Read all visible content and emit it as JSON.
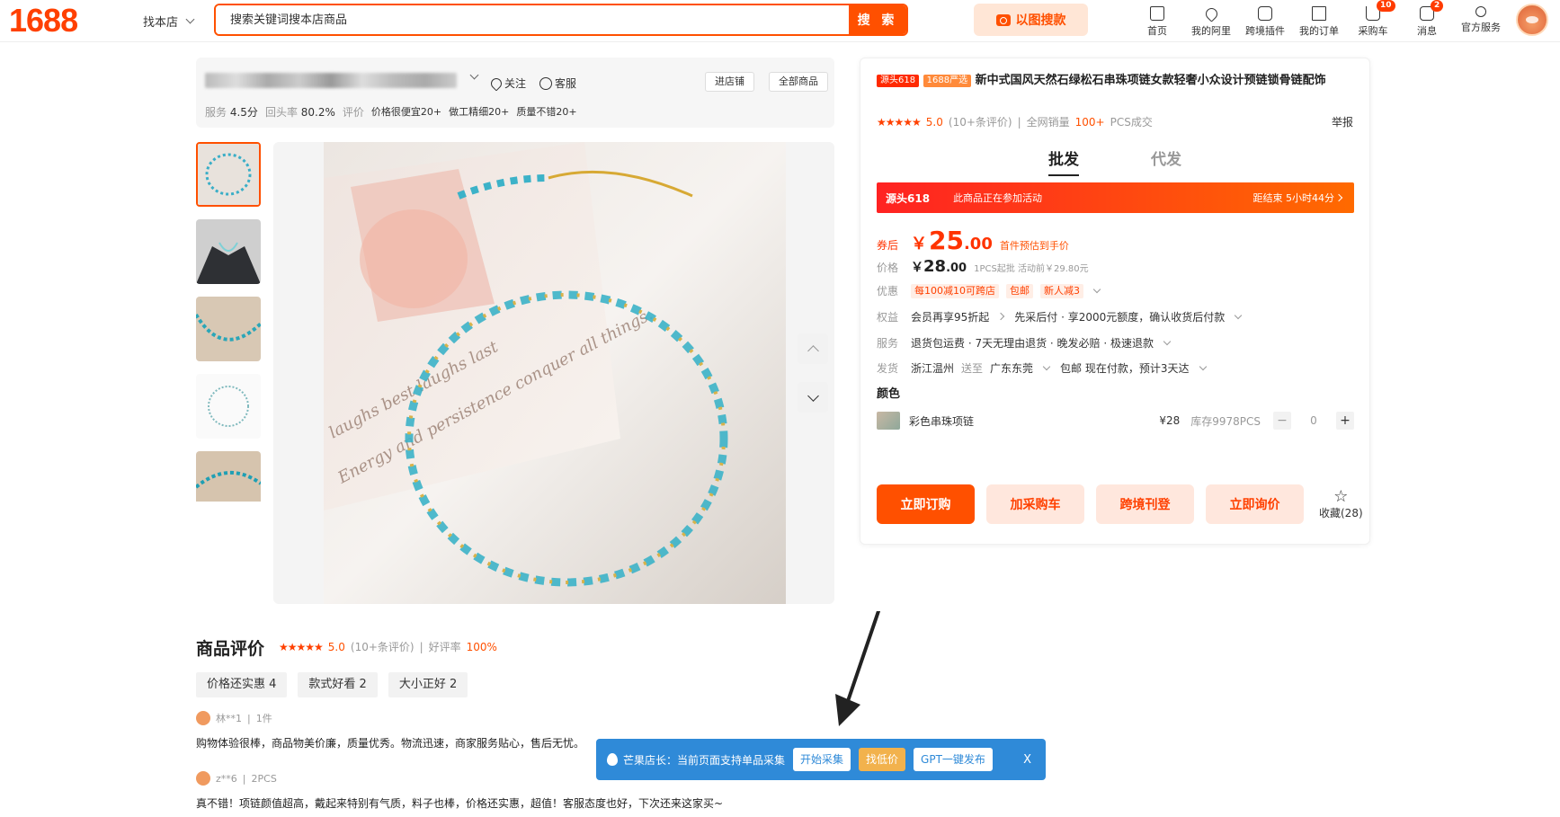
{
  "header": {
    "logo": "1688",
    "find_shop": "找本店",
    "search_placeholder": "搜索关键词搜本店商品",
    "search_button": "搜 索",
    "image_search": "以图搜款",
    "nav": [
      {
        "label": "首页",
        "icon": "home-icon",
        "badge": ""
      },
      {
        "label": "我的阿里",
        "icon": "heart-icon",
        "badge": ""
      },
      {
        "label": "跨境插件",
        "icon": "puzzle-icon",
        "badge": ""
      },
      {
        "label": "我的订单",
        "icon": "order-icon",
        "badge": ""
      },
      {
        "label": "采购车",
        "icon": "cart-icon",
        "badge": "10"
      },
      {
        "label": "消息",
        "icon": "message-icon",
        "badge": "2"
      },
      {
        "label": "官方服务",
        "icon": "user-icon",
        "badge": ""
      }
    ]
  },
  "shop": {
    "follow": "关注",
    "service": "客服",
    "enter_shop": "进店铺",
    "all_products": "全部商品",
    "service_label": "服务",
    "service_score": "4.5分",
    "repurchase_label": "回头率",
    "repurchase_rate": "80.2%",
    "review_label": "评价",
    "tags": [
      "价格很便宜20+",
      "做工精细20+",
      "质量不错20+"
    ]
  },
  "product": {
    "tag1": "源头618",
    "tag2": "1688严选",
    "title": "新中式国风天然石绿松石串珠项链女款轻奢小众设计预链锁骨链配饰",
    "rating_score": "5.0",
    "rating_count": "(10+条评价)",
    "sales_prefix": "全网销量",
    "sales_value": "100+",
    "sales_suffix": "PCS成交",
    "report": "举报",
    "tab_wholesale": "批发",
    "tab_dropship": "代发",
    "promo_label": "源头618",
    "promo_text": "此商品正在参加活动",
    "promo_countdown": "距结束 5小时44分",
    "coupon_label": "券后",
    "coupon_price_int": "25",
    "coupon_price_dec": ".00",
    "coupon_note": "首件预估到手价",
    "price_label": "价格",
    "price_int": "28",
    "price_dec": ".00",
    "price_note": "1PCS起批 活动前￥29.80元",
    "discount_label": "优惠",
    "discounts": [
      "每100减10可跨店",
      "包邮",
      "新人减3"
    ],
    "rights_label": "权益",
    "rights_1": "会员再享95折起",
    "rights_2": "先采后付 · 享2000元额度，确认收货后付款",
    "service_label": "服务",
    "services": "退货包运费 · 7天无理由退货 · 晚发必赔 · 极速退款",
    "ship_label": "发货",
    "ship_from": "浙江温州",
    "ship_to_prefix": "送至",
    "ship_to": "广东东莞",
    "ship_info": "包邮  现在付款，预计3天达",
    "color_title": "颜色",
    "sku_name": "彩色串珠项链",
    "sku_price": "¥28",
    "sku_stock": "库存9978PCS",
    "sku_qty": "0",
    "btn_order": "立即订购",
    "btn_cart": "加采购车",
    "btn_crossborder": "跨境刊登",
    "btn_inquiry": "立即询价",
    "favorite": "收藏(28)"
  },
  "reviews": {
    "title": "商品评价",
    "score": "5.0",
    "count": "(10+条评价)",
    "good_rate_label": "好评率",
    "good_rate": "100%",
    "tags": [
      "价格还实惠 4",
      "款式好看 2",
      "大小正好 2"
    ],
    "items": [
      {
        "user": "林**1",
        "qty": "1件",
        "text": "购物体验很棒，商品物美价廉，质量优秀。物流迅速，商家服务贴心，售后无忧。"
      },
      {
        "user": "z**6",
        "qty": "2PCS",
        "text": "真不错！项链颜值超高，戴起来特别有气质，料子也棒，价格还实惠，超值！客服态度也好，下次还来这家买~"
      }
    ]
  },
  "plugin": {
    "text": "芒果店长：当前页面支持单品采集",
    "btn_collect": "开始采集",
    "btn_lowprice": "找低价",
    "btn_gpt": "GPT一键发布",
    "close": "X"
  },
  "colors": {
    "brand": "#ff5000",
    "plugin_blue": "#2f8ad8"
  }
}
